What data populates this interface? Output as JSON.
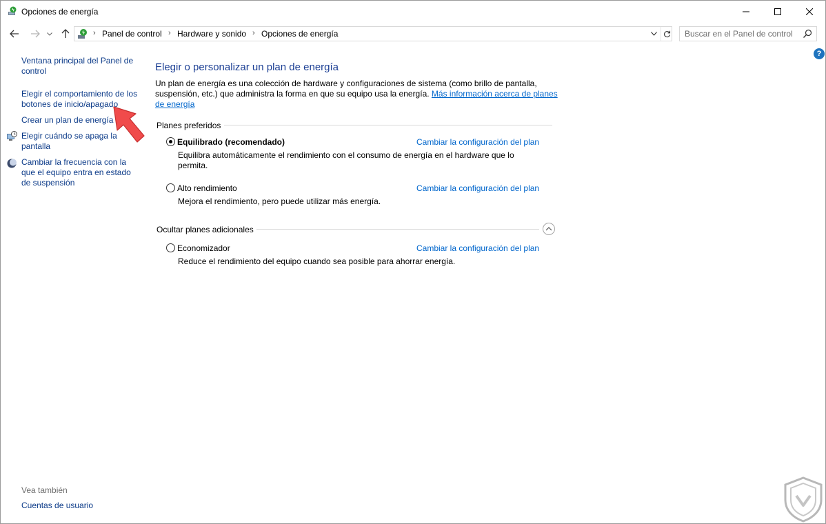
{
  "window": {
    "title": "Opciones de energía"
  },
  "address": {
    "breadcrumbs": [
      "Panel de control",
      "Hardware y sonido",
      "Opciones de energía"
    ],
    "search_placeholder": "Buscar en el Panel de control"
  },
  "sidebar": {
    "items": [
      {
        "label": "Ventana principal del Panel de control"
      },
      {
        "label": "Elegir el comportamiento de los botones de inicio/apagado"
      },
      {
        "label": "Crear un plan de energía"
      },
      {
        "label": "Elegir cuándo se apaga la pantalla"
      },
      {
        "label": "Cambiar la frecuencia con la que el equipo entra en estado de suspensión"
      }
    ],
    "see_also": "Vea también",
    "user_accounts": "Cuentas de usuario"
  },
  "help": {
    "label": "?"
  },
  "main": {
    "title": "Elegir o personalizar un plan de energía",
    "intro_text": "Un plan de energía es una colección de hardware y configuraciones de sistema (como brillo de pantalla, suspensión, etc.) que administra la forma en que su equipo usa la energía. ",
    "intro_link": "Más información acerca de planes de energía",
    "preferred_label": "Planes preferidos",
    "hidden_label": "Ocultar planes adicionales",
    "change_link": "Cambiar la configuración del plan",
    "plans": [
      {
        "name": "Equilibrado (recomendado)",
        "selected": true,
        "desc": "Equilibra automáticamente el rendimiento con el consumo de energía en el hardware que lo permita."
      },
      {
        "name": "Alto rendimiento",
        "selected": false,
        "desc": "Mejora el rendimiento, pero puede utilizar más energía."
      },
      {
        "name": "Economizador",
        "selected": false,
        "desc": "Reduce el rendimiento del equipo cuando sea posible para ahorrar energía."
      }
    ]
  },
  "colors": {
    "link": "#0066cc",
    "sidebar_link": "#0b3a88",
    "title": "#1c3f94",
    "callout_arrow": "#f04b4b"
  }
}
